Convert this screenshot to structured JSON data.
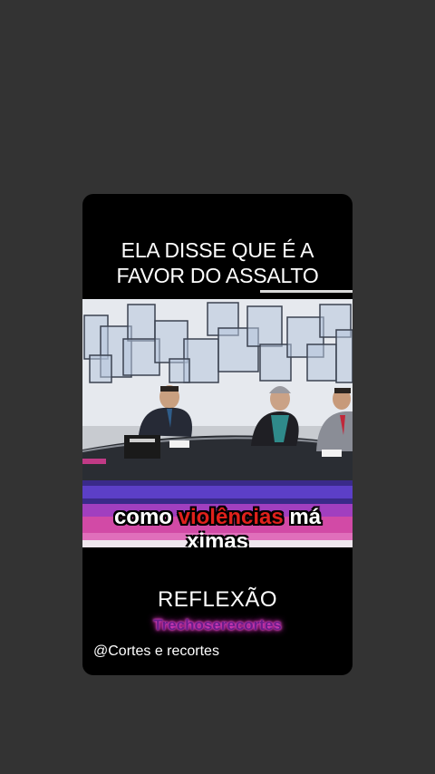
{
  "post": {
    "headline": "ELA DISSE QUE É A\nFAVOR DO ASSALTO",
    "caption": {
      "word1": "como",
      "word2": "violências",
      "word3": "má",
      "continuation": "ximas"
    },
    "reflexao": "REFLEXÃO",
    "watermark": "Trechoserecortes",
    "handle": "@Cortes e recortes"
  },
  "colors": {
    "background": "#333333",
    "card": "#000000",
    "caption_highlight": "#e0211c",
    "watermark_glow": "#ff3ad8"
  }
}
